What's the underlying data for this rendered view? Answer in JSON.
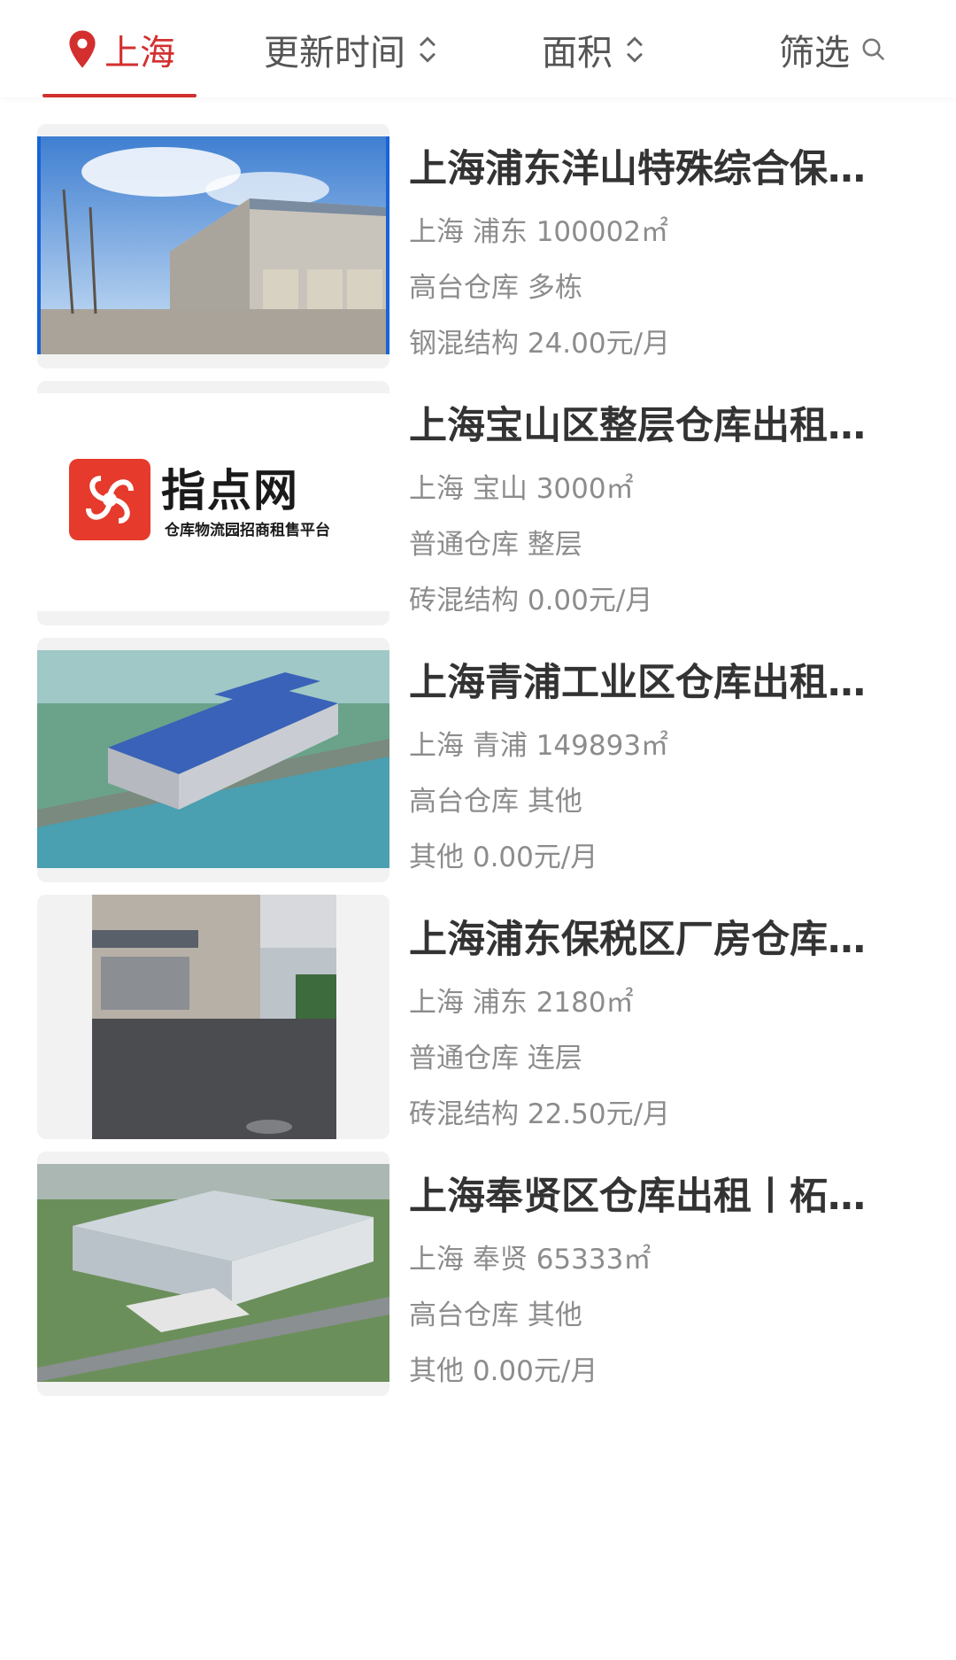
{
  "header": {
    "city": "上海",
    "sort_time_label": "更新时间",
    "sort_area_label": "面积",
    "filter_label": "筛选",
    "accent_color": "#d32f2f"
  },
  "listings": [
    {
      "title": "上海浦东洋山特殊综合保…",
      "location": "上海 浦东 100002㎡",
      "type": "高台仓库 多栋",
      "structure_price": "钢混结构 24.00元/月"
    },
    {
      "title": "上海宝山区整层仓库出租…",
      "location": "上海 宝山 3000㎡",
      "type": "普通仓库 整层",
      "structure_price": "砖混结构 0.00元/月",
      "logo_name": "指点网",
      "logo_tagline": "仓库物流园招商租售平台"
    },
    {
      "title": "上海青浦工业区仓库出租…",
      "location": "上海 青浦 149893㎡",
      "type": "高台仓库 其他",
      "structure_price": "其他 0.00元/月"
    },
    {
      "title": "上海浦东保税区厂房仓库…",
      "location": "上海 浦东 2180㎡",
      "type": "普通仓库 连层",
      "structure_price": "砖混结构 22.50元/月"
    },
    {
      "title": "上海奉贤区仓库出租丨柘…",
      "location": "上海 奉贤 65333㎡",
      "type": "高台仓库 其他",
      "structure_price": "其他 0.00元/月"
    }
  ]
}
